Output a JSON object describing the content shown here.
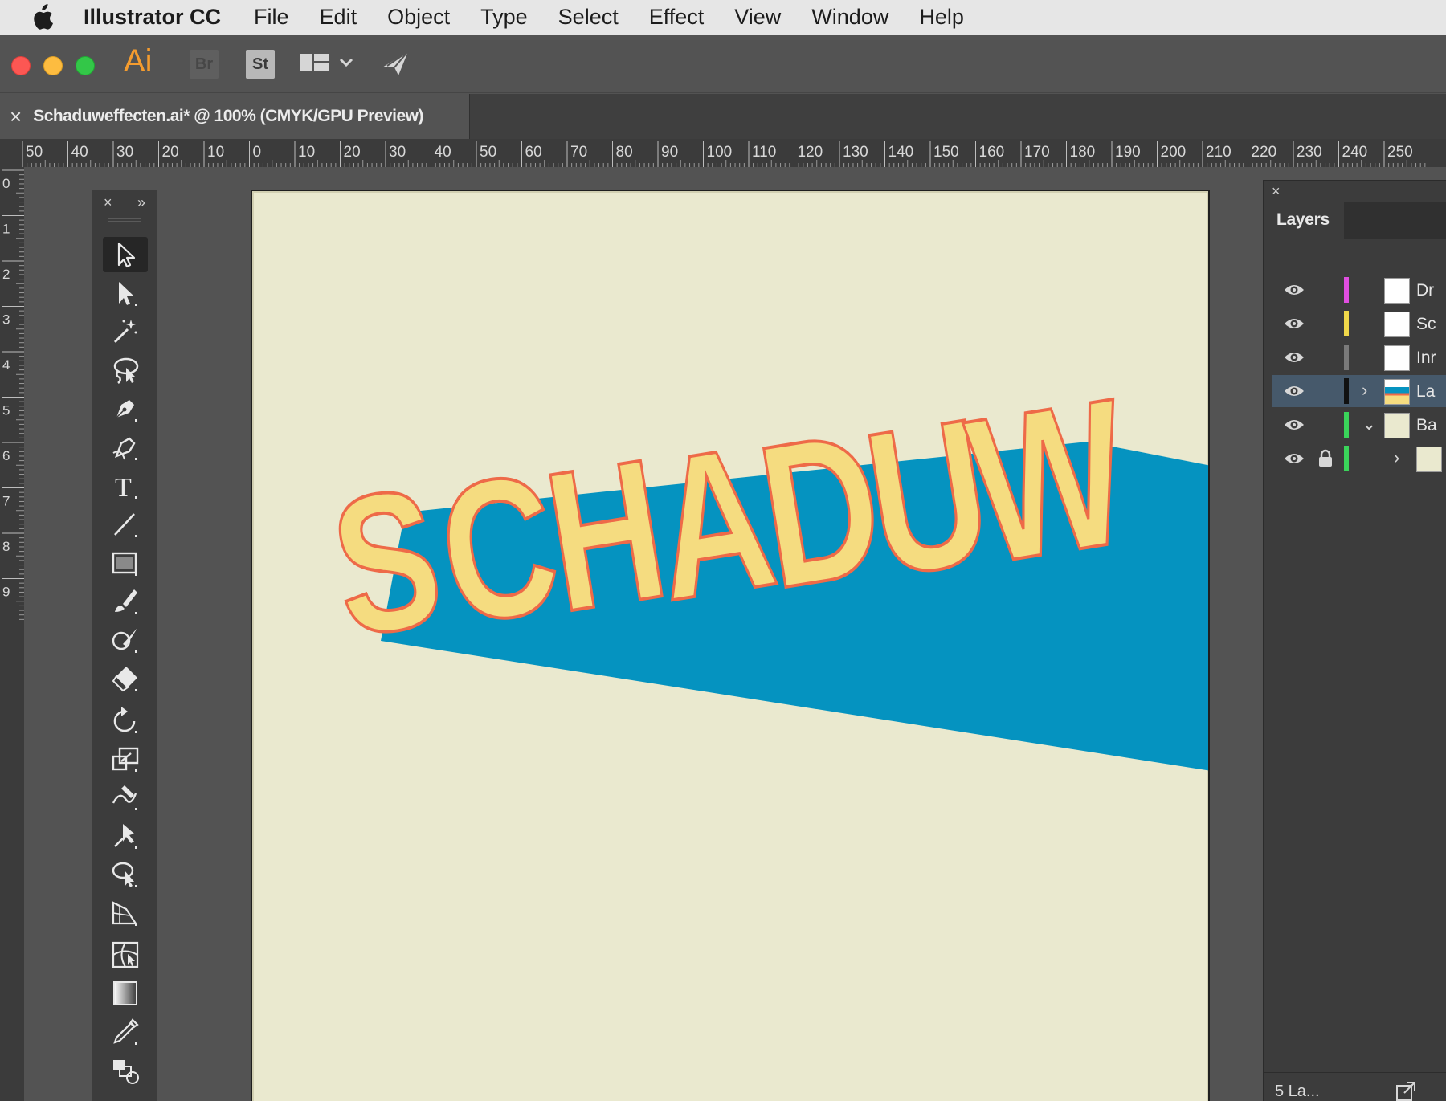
{
  "menubar": {
    "app_name": "Illustrator CC",
    "items": [
      "File",
      "Edit",
      "Object",
      "Type",
      "Select",
      "Effect",
      "View",
      "Window",
      "Help"
    ]
  },
  "appbar": {
    "logo": "Ai",
    "bridge": "Br",
    "stock": "St",
    "icons": [
      "bridge-icon",
      "stock-icon",
      "workspace-switcher-icon",
      "chevron-down-icon",
      "share-feedback-icon"
    ]
  },
  "document": {
    "tab_title": "Schaduweffecten.ai* @ 100% (CMYK/GPU Preview)",
    "close_glyph": "×"
  },
  "rulers": {
    "horizontal": [
      "50",
      "40",
      "30",
      "20",
      "10",
      "0",
      "10",
      "20",
      "30",
      "40",
      "50",
      "60",
      "70",
      "80",
      "90",
      "100",
      "110",
      "120",
      "130",
      "140",
      "150",
      "160",
      "170",
      "180",
      "190",
      "200",
      "210",
      "220",
      "230",
      "240",
      "250"
    ],
    "vertical": [
      "0",
      "1",
      "2",
      "3",
      "4",
      "5",
      "6",
      "7",
      "8",
      "9"
    ]
  },
  "tools": {
    "header_close": "×",
    "header_collapse": "»",
    "type_glyph": "T",
    "items": [
      "selection-tool-icon",
      "direct-selection-tool-icon",
      "magic-wand-tool-icon",
      "lasso-tool-icon",
      "pen-tool-icon",
      "curvature-tool-icon",
      "type-tool-icon",
      "line-segment-tool-icon",
      "rectangle-tool-icon",
      "paintbrush-tool-icon",
      "shaper-tool-icon",
      "eraser-tool-icon",
      "rotate-tool-icon",
      "scale-tool-icon",
      "warp-tool-icon",
      "puppet-warp-tool-icon",
      "shape-builder-tool-icon",
      "perspective-grid-tool-icon",
      "mesh-tool-icon",
      "gradient-tool-icon",
      "eyedropper-tool-icon",
      "blend-tool-icon"
    ]
  },
  "artwork": {
    "text": "SCHADUW",
    "letters": [
      "S",
      "C",
      "H",
      "A",
      "D",
      "U",
      "W"
    ],
    "artboard_color": "#eae9cf",
    "shadow_color": "#0593c0",
    "letter_fill": "#f5dc80",
    "letter_stroke": "#ee6a48"
  },
  "layers": {
    "panel_close": "×",
    "tab_label": "Layers",
    "rows": [
      {
        "name": "Dr",
        "color": "#e04ee0",
        "twirl": "",
        "locked": false,
        "selected": false
      },
      {
        "name": "Sc",
        "color": "#f0d84a",
        "twirl": "",
        "locked": false,
        "selected": false
      },
      {
        "name": "Inr",
        "color": "#7a7a7a",
        "twirl": "",
        "locked": false,
        "selected": false
      },
      {
        "name": "La",
        "color": "#111111",
        "twirl": "›",
        "locked": false,
        "selected": true
      },
      {
        "name": "Ba",
        "color": "#3ad45a",
        "twirl": "⌄",
        "locked": false,
        "selected": false
      },
      {
        "name": "",
        "color": "#3ad45a",
        "twirl": "›",
        "locked": true,
        "selected": false
      }
    ],
    "footer_count": "5 La..."
  }
}
